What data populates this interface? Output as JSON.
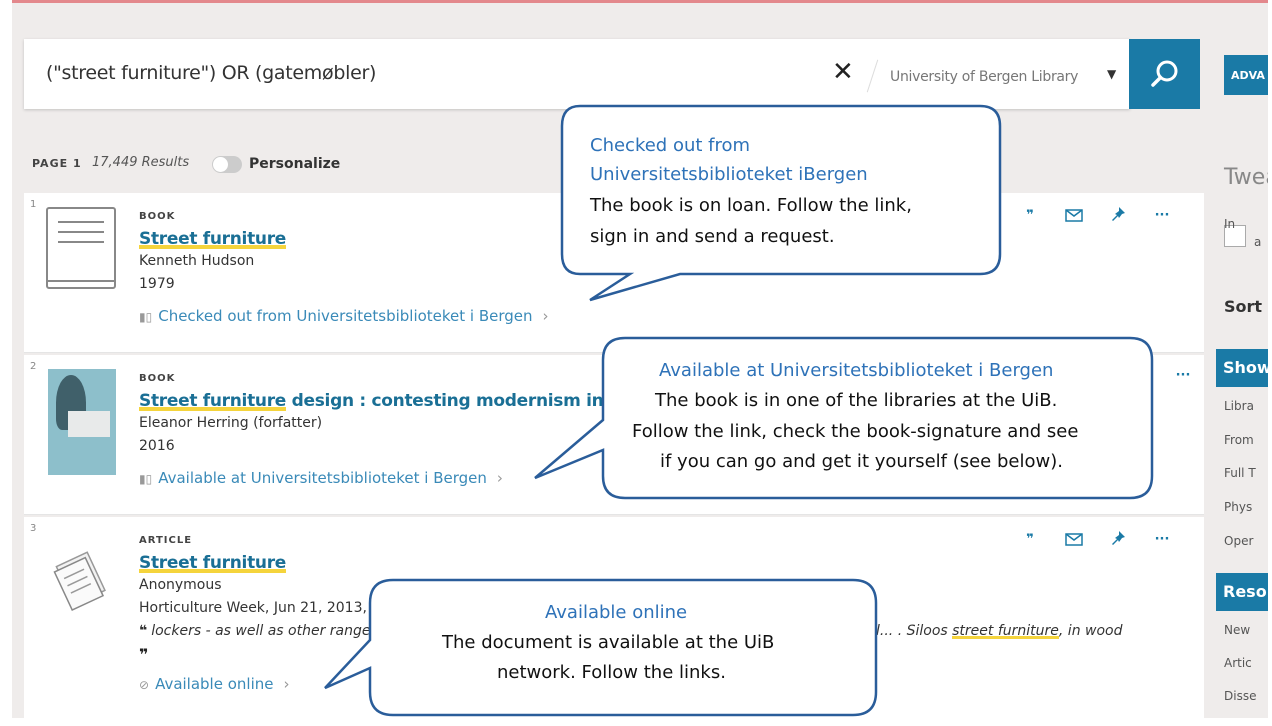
{
  "search": {
    "query": "(\"street furniture\") OR (gatemøbler)",
    "scope": "University of Bergen Library",
    "advanced_label": "ADVA"
  },
  "results_header": {
    "page_label": "PAGE 1",
    "count": "17,449 Results",
    "personalize_label": "Personalize"
  },
  "results": [
    {
      "number": "1",
      "type": "BOOK",
      "title_highlight": "Street furniture",
      "title_rest": "",
      "author": "Kenneth Hudson",
      "year": "1979",
      "availability": "Checked out from Universitetsbiblioteket i Bergen",
      "availability_icon": "book-icon"
    },
    {
      "number": "2",
      "type": "BOOK",
      "title_highlight": "Street furniture",
      "title_rest": " design : contesting modernism in post",
      "author": "Eleanor Herring (forfatter)",
      "year": "2016",
      "availability": "Available at Universitetsbiblioteket i Bergen",
      "availability_icon": "book-icon"
    },
    {
      "number": "3",
      "type": "ARTICLE",
      "title_highlight": "Street furniture",
      "author": "Anonymous",
      "source": "Horticulture Week, Jun 21, 2013,",
      "snippet_left": "lockers - as well as other range",
      "snippet_right_pre": "l... . Siloos ",
      "snippet_right_hl": "street furniture",
      "snippet_right_post": ", in wood",
      "availability": "Available online",
      "availability_icon": "link-icon"
    }
  ],
  "sidebar": {
    "tweak_label": "Twea",
    "checkbox_line1": "In",
    "checkbox_line2": "a",
    "sort_label": "Sort b",
    "show_label": "Show",
    "show_items": [
      "Libra",
      "From",
      "Full T",
      "Phys",
      "Oper"
    ],
    "resource_label": "Reso",
    "resource_items": [
      "New",
      "Artic",
      "Disse"
    ]
  },
  "callouts": {
    "c1": {
      "title_line1": "Checked out from",
      "title_line2": "Universitetsbiblioteket iBergen",
      "body_line1": "The book is on loan. Follow the link,",
      "body_line2": "sign in and send a request."
    },
    "c2": {
      "title": "Available at Universitetsbiblioteket i Bergen",
      "body_line1": "The book is in one of the libraries at the UiB.",
      "body_line2": "Follow the link, check the book-signature and see",
      "body_line3": "if you can go and get it yourself (see below)."
    },
    "c3": {
      "title": "Available online",
      "body_line1": "The document is available at the UiB",
      "body_line2": "network. Follow the links."
    }
  },
  "colors": {
    "accent": "#1a7aa6",
    "link": "#1a6f95",
    "callout_border": "#2a5d9a",
    "callout_title": "#2e72b8",
    "highlight": "#f5d43c"
  }
}
